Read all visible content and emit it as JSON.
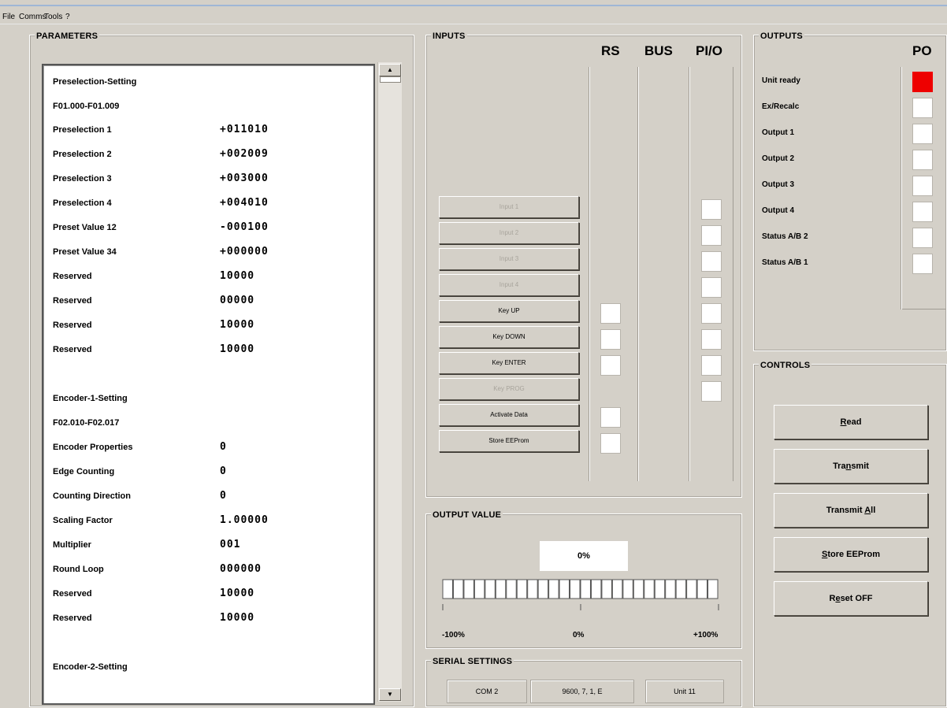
{
  "menu": {
    "items": [
      "File",
      "Comms",
      "Tools",
      "?"
    ]
  },
  "parameters": {
    "title": "PARAMETERS",
    "rows": [
      {
        "label": "Preselection-Setting",
        "value": ""
      },
      {
        "label": "F01.000-F01.009",
        "value": ""
      },
      {
        "label": "Preselection 1",
        "value": "+011010"
      },
      {
        "label": "Preselection 2",
        "value": "+002009"
      },
      {
        "label": "Preselection 3",
        "value": "+003000"
      },
      {
        "label": "Preselection 4",
        "value": "+004010"
      },
      {
        "label": "Preset Value 12",
        "value": "-000100"
      },
      {
        "label": "Preset Value 34",
        "value": "+000000"
      },
      {
        "label": "Reserved",
        "value": "10000"
      },
      {
        "label": "Reserved",
        "value": "00000"
      },
      {
        "label": "Reserved",
        "value": "10000"
      },
      {
        "label": "Reserved",
        "value": "10000"
      },
      {
        "label": "Encoder-1-Setting",
        "value": ""
      },
      {
        "label": "F02.010-F02.017",
        "value": ""
      },
      {
        "label": "Encoder Properties",
        "value": "0"
      },
      {
        "label": "Edge Counting",
        "value": "0"
      },
      {
        "label": "Counting Direction",
        "value": "0"
      },
      {
        "label": "Scaling Factor",
        "value": "1.00000"
      },
      {
        "label": "Multiplier",
        "value": "001"
      },
      {
        "label": "Round Loop",
        "value": "000000"
      },
      {
        "label": "Reserved",
        "value": "10000"
      },
      {
        "label": "Reserved",
        "value": "10000"
      },
      {
        "label": "Encoder-2-Setting",
        "value": ""
      }
    ],
    "scroll_up": "▲",
    "scroll_down": "▼"
  },
  "inputs": {
    "title": "INPUTS",
    "columns": [
      "RS",
      "BUS",
      "PI/O"
    ],
    "buttons": [
      {
        "label": "Input 1",
        "enabled": false
      },
      {
        "label": "Input 2",
        "enabled": false
      },
      {
        "label": "Input 3",
        "enabled": false
      },
      {
        "label": "Input 4",
        "enabled": false
      },
      {
        "label": "Key UP",
        "enabled": true
      },
      {
        "label": "Key DOWN",
        "enabled": true
      },
      {
        "label": "Key ENTER",
        "enabled": true
      },
      {
        "label": "Key PROG",
        "enabled": false
      },
      {
        "label": "Activate Data",
        "enabled": true
      },
      {
        "label": "Store EEProm",
        "enabled": true
      }
    ]
  },
  "outputs": {
    "title": "OUTPUTS",
    "column": "PO",
    "items": [
      {
        "label": "Unit ready",
        "active": true
      },
      {
        "label": "Ex/Recalc",
        "active": false
      },
      {
        "label": "Output 1",
        "active": false
      },
      {
        "label": "Output 2",
        "active": false
      },
      {
        "label": "Output 3",
        "active": false
      },
      {
        "label": "Output 4",
        "active": false
      },
      {
        "label": "Status A/B 2",
        "active": false
      },
      {
        "label": "Status A/B 1",
        "active": false
      }
    ],
    "active_color": "#ee0000"
  },
  "controls": {
    "title": "CONTROLS",
    "buttons": [
      {
        "pre": "",
        "mn": "R",
        "post": "ead"
      },
      {
        "pre": "Tra",
        "mn": "n",
        "post": "smit"
      },
      {
        "pre": "Transmit ",
        "mn": "A",
        "post": "ll"
      },
      {
        "pre": "",
        "mn": "S",
        "post": "tore EEProm"
      },
      {
        "pre": "R",
        "mn": "e",
        "post": "set OFF"
      }
    ]
  },
  "output_value": {
    "title": "OUTPUT VALUE",
    "display": "0%",
    "value_percent": 0,
    "segments": 26,
    "scale_min": "-100%",
    "scale_mid": "0%",
    "scale_max": "+100%"
  },
  "serial": {
    "title": "SERIAL SETTINGS",
    "port": "COM 2",
    "params": "9600, 7, 1, E",
    "unit": "Unit 11"
  }
}
